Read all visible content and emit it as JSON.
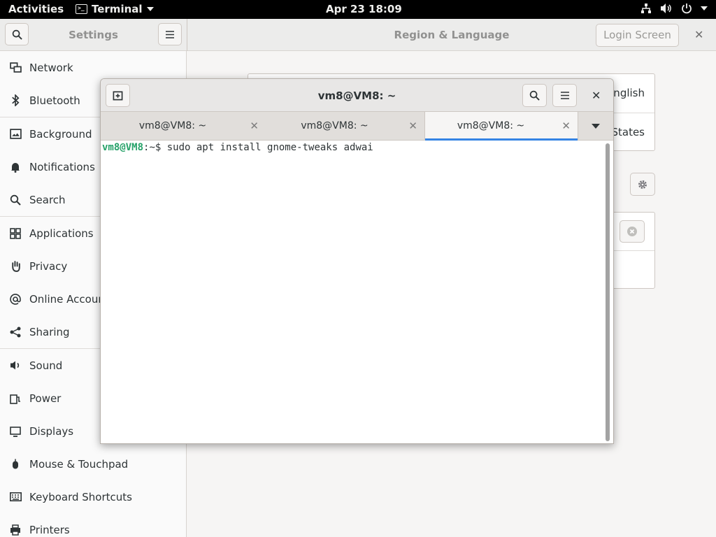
{
  "topbar": {
    "activities": "Activities",
    "app_name": "Terminal",
    "clock": "Apr 23  18:09"
  },
  "settings": {
    "sidebar_title": "Settings",
    "panel_title": "Region & Language",
    "login_screen_label": "Login Screen",
    "sidebar_items": [
      {
        "label": "Network",
        "icon": "network-icon"
      },
      {
        "label": "Bluetooth",
        "icon": "bluetooth-icon"
      },
      {
        "label": "Background",
        "icon": "background-icon"
      },
      {
        "label": "Notifications",
        "icon": "bell-icon"
      },
      {
        "label": "Search",
        "icon": "search-icon"
      },
      {
        "label": "Applications",
        "icon": "grid-icon"
      },
      {
        "label": "Privacy",
        "icon": "hand-icon"
      },
      {
        "label": "Online Accounts",
        "icon": "at-icon"
      },
      {
        "label": "Sharing",
        "icon": "share-icon"
      },
      {
        "label": "Sound",
        "icon": "speaker-icon"
      },
      {
        "label": "Power",
        "icon": "power-icon"
      },
      {
        "label": "Displays",
        "icon": "display-icon"
      },
      {
        "label": "Mouse & Touchpad",
        "icon": "mouse-icon"
      },
      {
        "label": "Keyboard Shortcuts",
        "icon": "keyboard-icon"
      },
      {
        "label": "Printers",
        "icon": "printer-icon"
      }
    ],
    "language_value": "English",
    "formats_value": "States"
  },
  "terminal": {
    "title": "vm8@VM8: ~",
    "tabs": [
      {
        "label": "vm8@VM8: ~"
      },
      {
        "label": "vm8@VM8: ~"
      },
      {
        "label": "vm8@VM8: ~"
      }
    ],
    "prompt_user": "vm8@VM8",
    "prompt_path": ":~",
    "prompt_symbol": "$ ",
    "command": "sudo apt install gnome-tweaks adwai"
  }
}
